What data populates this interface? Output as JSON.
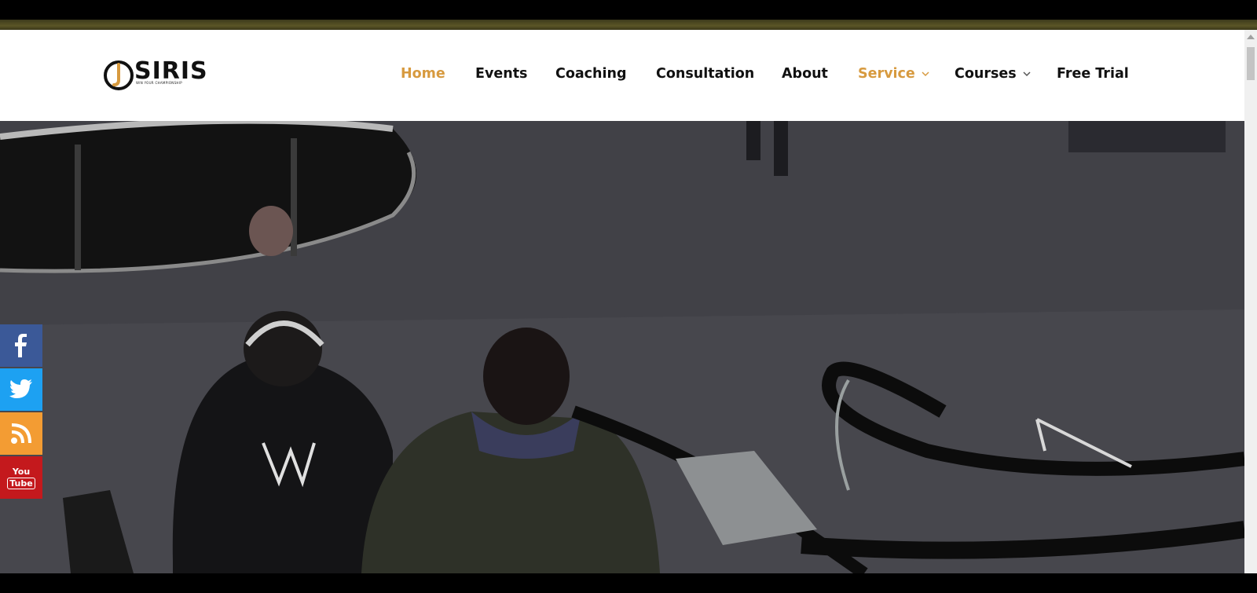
{
  "logo": {
    "wordmark": "SIRIS",
    "tagline": "WIN YOUR CHAMPIONSHIP"
  },
  "nav": {
    "items": [
      {
        "label": "Home",
        "active": true
      },
      {
        "label": "Events"
      },
      {
        "label": "Coaching"
      },
      {
        "label": "Consultation"
      },
      {
        "label": "About"
      },
      {
        "label": "Service",
        "has_dropdown": true
      },
      {
        "label": "Courses",
        "has_dropdown": true
      },
      {
        "label": "Free Trial"
      }
    ]
  },
  "colors": {
    "accent": "#d79a3f",
    "nav_text": "#111111",
    "facebook": "#3b5998",
    "twitter": "#1da1f2",
    "rss": "#f39c33",
    "youtube": "#c4191d"
  },
  "social": {
    "youtube_top": "You",
    "youtube_bottom": "Tube"
  },
  "hero": {
    "icon": "video-background-escalator-scene"
  }
}
